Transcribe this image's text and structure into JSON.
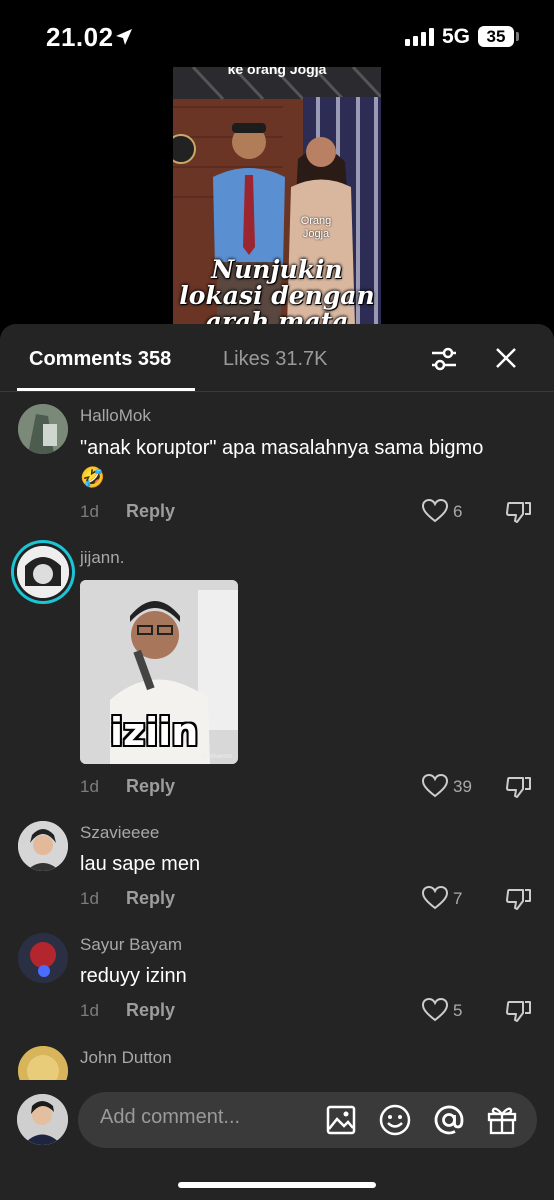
{
  "status_bar": {
    "time": "21.02",
    "network": "5G",
    "battery": "35",
    "icons": [
      "location-arrow-icon",
      "signal-icon",
      "battery-icon"
    ]
  },
  "video": {
    "caption_top": "ke orang Jogja",
    "label": "Orang Jogja",
    "caption": "Nunjukin lokasi dengan arah mata"
  },
  "tabs": {
    "comments": "Comments 358",
    "likes": "Likes 31.7K",
    "icons": [
      "filter-icon",
      "close-icon"
    ]
  },
  "comments": [
    {
      "username": "HalloMok",
      "text": "\"anak koruptor\" apa masalahnya sama bigmo",
      "emoji": "🤣",
      "time": "1d",
      "reply": "Reply",
      "likes": "6"
    },
    {
      "username": "jijann.",
      "sticker_text": "iziin",
      "sticker_watermark": "@iciliverrnn",
      "time": "1d",
      "reply": "Reply",
      "likes": "39"
    },
    {
      "username": "Szavieeee",
      "text": "lau sape men",
      "time": "1d",
      "reply": "Reply",
      "likes": "7"
    },
    {
      "username": "Sayur Bayam",
      "text": "reduyy izinn",
      "time": "1d",
      "reply": "Reply",
      "likes": "5"
    },
    {
      "username": "John Dutton"
    }
  ],
  "input": {
    "placeholder": "Add comment...",
    "icons": [
      "image-icon",
      "emoji-icon",
      "mention-icon",
      "gift-icon"
    ]
  }
}
